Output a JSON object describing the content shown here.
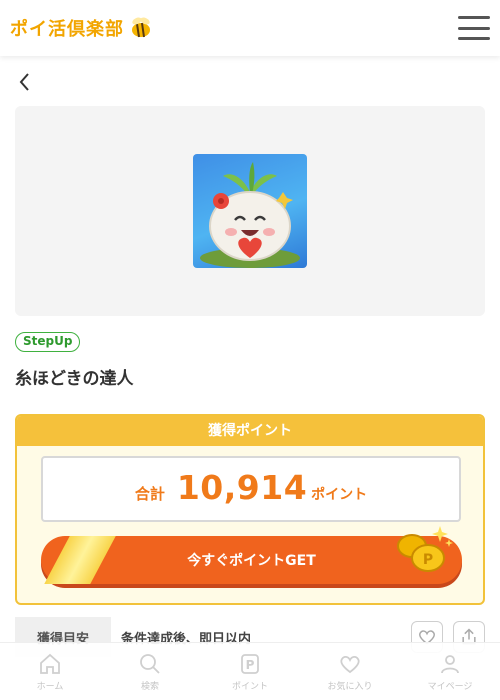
{
  "header": {
    "logo_text": "ポイ活倶楽部",
    "logo_icon": "bee-icon",
    "menu_icon": "hamburger-icon"
  },
  "nav": {
    "back_icon": "chevron-left-icon"
  },
  "campaign": {
    "badge": "StepUp",
    "title": "糸ほどきの達人"
  },
  "points": {
    "header": "獲得ポイント",
    "total_label": "合計",
    "total_value": "10,914",
    "total_unit": "ポイント",
    "get_button_label": "今すぐポイントGET"
  },
  "details": {
    "label": "獲得目安",
    "value": "条件達成後、即日以内"
  },
  "actions": {
    "favorite_icon": "heart-icon",
    "share_icon": "share-icon"
  },
  "bottom_nav": [
    {
      "label": "ホーム",
      "icon": "home-icon"
    },
    {
      "label": "検索",
      "icon": "search-icon"
    },
    {
      "label": "ポイント",
      "icon": "point-icon"
    },
    {
      "label": "お気に入り",
      "icon": "heart-icon"
    },
    {
      "label": "マイページ",
      "icon": "user-icon"
    }
  ],
  "colors": {
    "brand_yellow": "#f5c13b",
    "accent_orange": "#f07a1a",
    "button_orange": "#f0631e",
    "badge_green": "#3fb13f"
  }
}
